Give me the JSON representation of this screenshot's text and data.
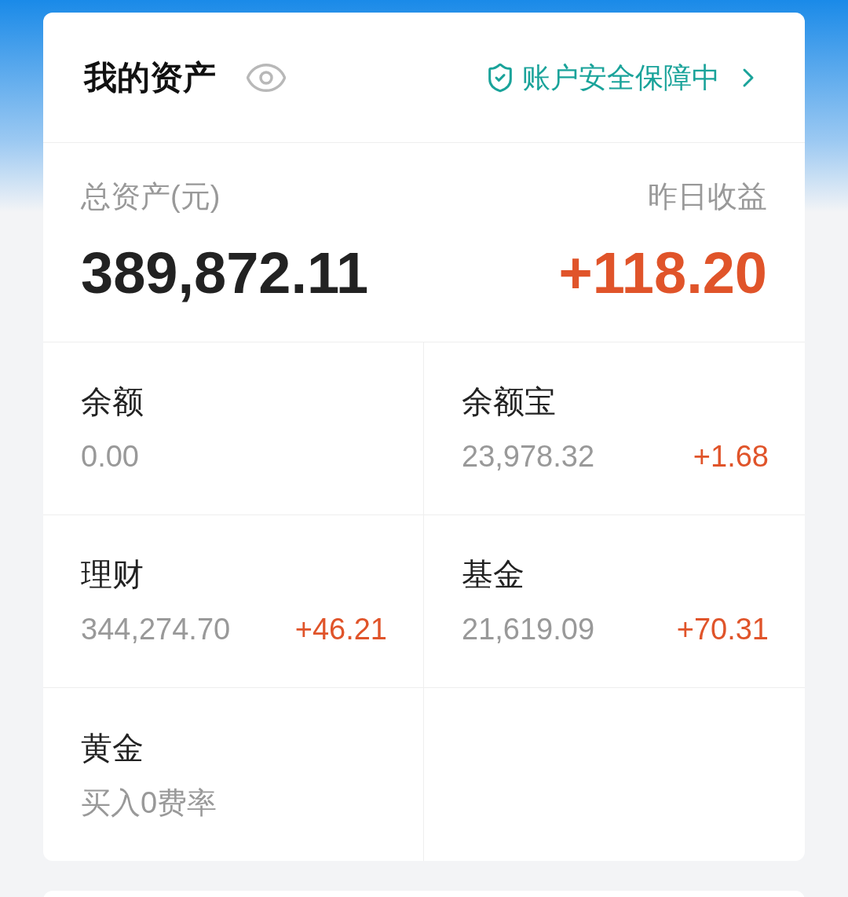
{
  "header": {
    "title": "我的资产",
    "security": "账户安全保障中"
  },
  "summary": {
    "total_label": "总资产(元)",
    "total": "389,872.11",
    "yesterday_label": "昨日收益",
    "yesterday": "+118.20"
  },
  "assets": [
    {
      "name": "余额",
      "amount": "0.00"
    },
    {
      "name": "余额宝",
      "amount": "23,978.32",
      "gain": "+1.68"
    },
    {
      "name": "理财",
      "amount": "344,274.70",
      "gain": "+46.21"
    },
    {
      "name": "基金",
      "amount": "21,619.09",
      "gain": "+70.31"
    },
    {
      "name": "黄金",
      "amount": "买入0费率"
    }
  ]
}
